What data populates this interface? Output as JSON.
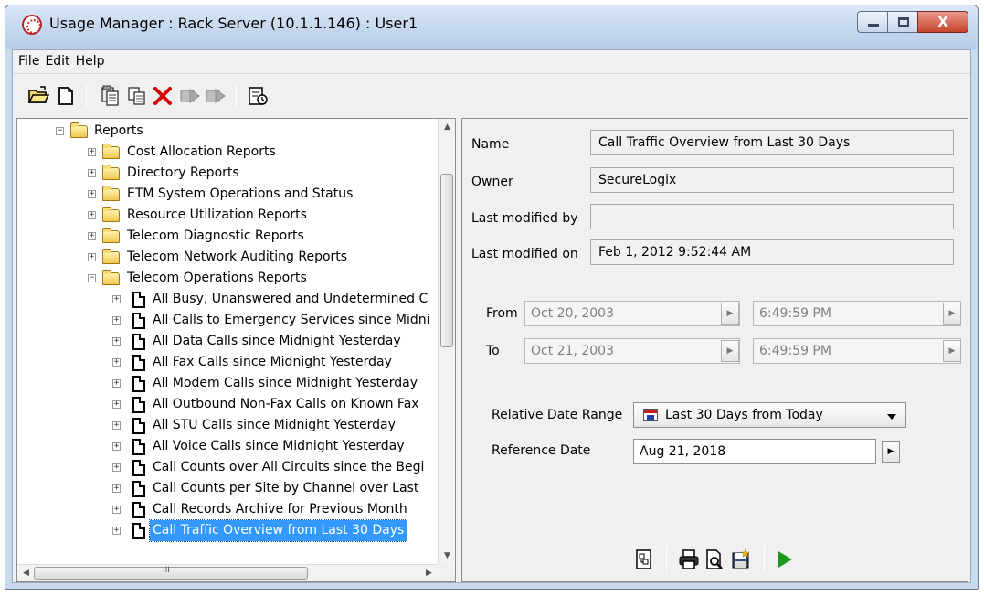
{
  "window": {
    "title": "Usage Manager : Rack Server (10.1.1.146) : User1",
    "close_glyph": "X"
  },
  "menu": [
    "File",
    "Edit",
    "Help"
  ],
  "toolbar": {
    "buttons": [
      "open-folder-icon",
      "new-document-icon",
      "properties-icon",
      "copy-icon",
      "delete-icon",
      "export-icon",
      "import-icon",
      "schedule-report-icon"
    ]
  },
  "tree": {
    "root": "Reports",
    "folders": [
      "Cost Allocation Reports",
      "Directory Reports",
      "ETM System Operations and Status",
      "Resource Utilization Reports",
      "Telecom Diagnostic Reports",
      "Telecom Network Auditing Reports",
      "Telecom Operations Reports"
    ],
    "reports": [
      "All Busy, Unanswered and Undetermined C",
      "All Calls to Emergency Services since Midni",
      "All Data Calls since Midnight Yesterday",
      "All Fax Calls since Midnight Yesterday",
      "All Modem Calls since Midnight Yesterday",
      "All Outbound Non-Fax Calls on Known Fax",
      "All STU Calls since Midnight Yesterday",
      "All Voice Calls since Midnight Yesterday",
      "Call Counts over All Circuits since the Begi",
      "Call Counts per Site by Channel over Last",
      "Call Records Archive for Previous Month",
      "Call Traffic Overview from Last 30 Days"
    ],
    "selected_report": "Call Traffic Overview from Last 30 Days",
    "expand_glyph": "+",
    "collapse_glyph": "−",
    "hscroll_grip": "III"
  },
  "details": {
    "name_label": "Name",
    "name_value": "Call Traffic Overview from Last 30 Days",
    "owner_label": "Owner",
    "owner_value": "SecureLogix",
    "modified_by_label": "Last modified by",
    "modified_by_value": "",
    "modified_on_label": "Last modified on",
    "modified_on_value": "Feb 1, 2012 9:52:44 AM",
    "from_label": "From",
    "from_date": "Oct 20, 2003",
    "from_time": "6:49:59 PM",
    "to_label": "To",
    "to_date": "Oct 21, 2003",
    "to_time": "6:49:59 PM",
    "relative_label": "Relative Date Range",
    "relative_value": "Last 30 Days from Today",
    "reference_label": "Reference Date",
    "reference_value": "Aug 21, 2018"
  },
  "actions": [
    "report-layout-icon",
    "print-icon",
    "print-preview-icon",
    "save-report-icon",
    "run-report-icon"
  ],
  "colors": {
    "selection": "#3399ff",
    "title_bar": "#c7d9ee",
    "run_green": "#1a9a1a",
    "delete_red": "#d40000"
  }
}
